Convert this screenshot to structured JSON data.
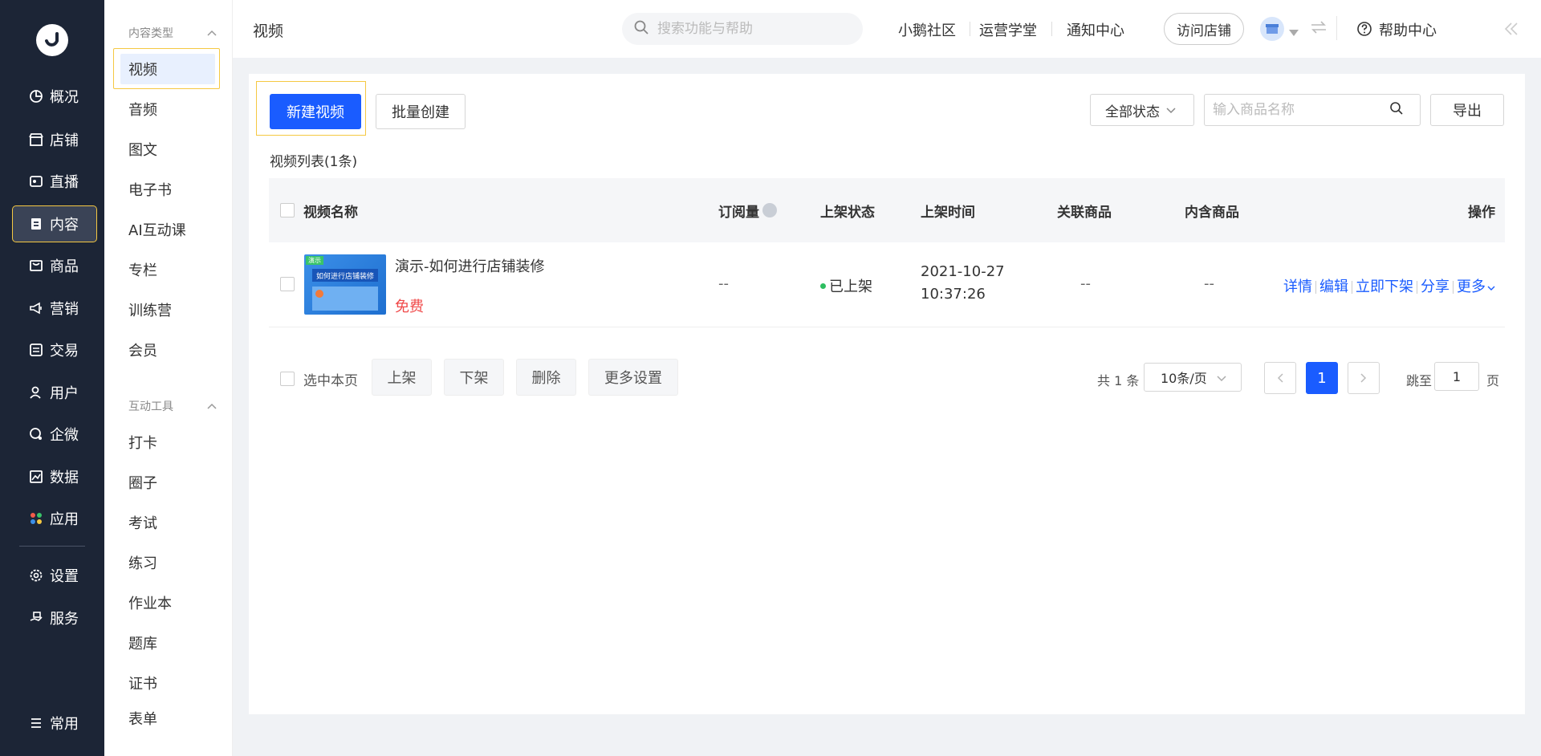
{
  "nav1": {
    "items": [
      {
        "label": "概况",
        "icon": "pie-chart-icon"
      },
      {
        "label": "店铺",
        "icon": "shop-icon"
      },
      {
        "label": "直播",
        "icon": "live-icon"
      },
      {
        "label": "内容",
        "icon": "content-icon"
      },
      {
        "label": "商品",
        "icon": "bag-icon"
      },
      {
        "label": "营销",
        "icon": "megaphone-icon"
      },
      {
        "label": "交易",
        "icon": "trade-icon"
      },
      {
        "label": "用户",
        "icon": "user-icon"
      },
      {
        "label": "企微",
        "icon": "chat-icon"
      },
      {
        "label": "数据",
        "icon": "data-icon"
      },
      {
        "label": "应用",
        "icon": "apps-icon"
      },
      {
        "label": "设置",
        "icon": "gear-icon"
      },
      {
        "label": "服务",
        "icon": "service-icon"
      },
      {
        "label": "常用",
        "icon": "list-icon"
      }
    ]
  },
  "nav2": {
    "group1": "内容类型",
    "group1_items": [
      "视频",
      "音频",
      "图文",
      "电子书",
      "AI互动课",
      "专栏",
      "训练营",
      "会员"
    ],
    "group2": "互动工具",
    "group2_items": [
      "打卡",
      "圈子",
      "考试",
      "练习",
      "作业本",
      "题库",
      "证书",
      "表单"
    ]
  },
  "header": {
    "title": "视频",
    "search_placeholder": "搜索功能与帮助",
    "links": [
      "小鹅社区",
      "运营学堂",
      "通知中心"
    ],
    "visit_store": "访问店铺",
    "help": "帮助中心"
  },
  "toolbar": {
    "new_video": "新建视频",
    "batch_create": "批量创建",
    "status_select": "全部状态",
    "search_placeholder": "输入商品名称",
    "export": "导出"
  },
  "list": {
    "title": "视频列表(1条)",
    "columns": [
      "视频名称",
      "订阅量",
      "上架状态",
      "上架时间",
      "关联商品",
      "内含商品",
      "操作"
    ],
    "rows": [
      {
        "name": "演示-如何进行店铺装修",
        "price": "免费",
        "thumb_title": "如何进行店铺装修",
        "thumb_tag": "演示",
        "subs": "--",
        "status": "已上架",
        "date": "2021-10-27",
        "time": "10:37:26",
        "related": "--",
        "contains": "--",
        "ops": [
          "详情",
          "编辑",
          "立即下架",
          "分享",
          "更多"
        ]
      }
    ]
  },
  "footer": {
    "select_page": "选中本页",
    "actions": [
      "上架",
      "下架",
      "删除",
      "更多设置"
    ],
    "total": "共 1 条",
    "page_size": "10条/页",
    "current_page": "1",
    "jump_label": "跳至",
    "jump_value": "1",
    "page_suffix": "页"
  },
  "colors": {
    "primary": "#1a5cff",
    "nav_bg": "#1c2536",
    "status_green": "#2dbe60",
    "price_red": "#f04a4a"
  }
}
